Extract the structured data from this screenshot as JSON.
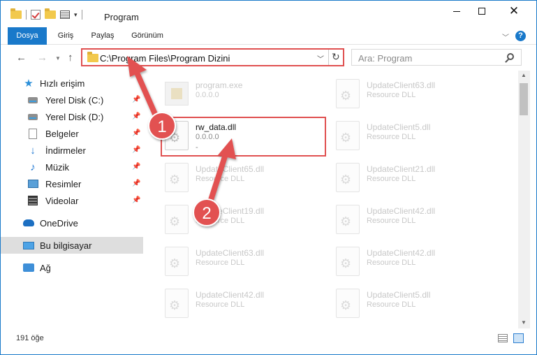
{
  "window": {
    "title": "Program"
  },
  "ribbon": {
    "tabs": [
      "Dosya",
      "Giriş",
      "Paylaş",
      "Görünüm"
    ],
    "help": "?"
  },
  "address": {
    "path": "C:\\Program Files\\Program Dizini"
  },
  "search": {
    "placeholder": "Ara: Program"
  },
  "sidebar": {
    "items": [
      {
        "label": "Hızlı erişim",
        "icon": "star-icon"
      },
      {
        "label": "Yerel Disk (C:)",
        "icon": "drive-icon"
      },
      {
        "label": "Yerel Disk (D:)",
        "icon": "drive-icon"
      },
      {
        "label": "Belgeler",
        "icon": "document-icon"
      },
      {
        "label": "İndirmeler",
        "icon": "download-icon"
      },
      {
        "label": "Müzik",
        "icon": "music-icon"
      },
      {
        "label": "Resimler",
        "icon": "picture-icon"
      },
      {
        "label": "Videolar",
        "icon": "video-icon"
      },
      {
        "label": "OneDrive",
        "icon": "cloud-icon"
      },
      {
        "label": "Bu bilgisayar",
        "icon": "computer-icon"
      },
      {
        "label": "Ağ",
        "icon": "network-icon"
      }
    ]
  },
  "files": {
    "left": [
      {
        "name": "program.exe",
        "sub": "0.0.0.0"
      },
      {
        "name": "rw_data.dll",
        "sub": "0.0.0.0",
        "sub2": "-"
      },
      {
        "name": "UpdateClient65.dll",
        "sub": "Resource DLL"
      },
      {
        "name": "UpdateClient19.dll",
        "sub": "Resource DLL"
      },
      {
        "name": "UpdateClient63.dll",
        "sub": "Resource DLL"
      },
      {
        "name": "UpdateClient42.dll",
        "sub": "Resource DLL"
      }
    ],
    "right": [
      {
        "name": "UpdateClient63.dll",
        "sub": "Resource DLL"
      },
      {
        "name": "UpdateClient5.dll",
        "sub": "Resource DLL"
      },
      {
        "name": "UpdateClient21.dll",
        "sub": "Resource DLL"
      },
      {
        "name": "UpdateClient42.dll",
        "sub": "Resource DLL"
      },
      {
        "name": "UpdateClient42.dll",
        "sub": "Resource DLL"
      },
      {
        "name": "UpdateClient5.dll",
        "sub": "Resource DLL"
      }
    ]
  },
  "status": {
    "count": "191 öğe"
  },
  "annotations": {
    "step1": "1",
    "step2": "2",
    "color": "#e25151"
  }
}
